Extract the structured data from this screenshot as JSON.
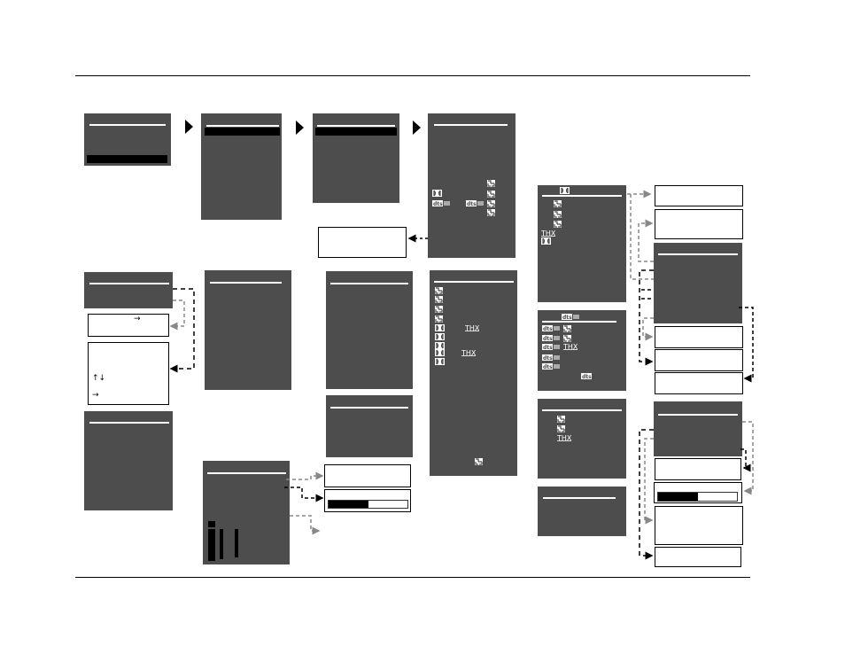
{
  "diagram": {
    "title": "",
    "colors": {
      "panel": "#4d4d4d",
      "underline": "#ffffff",
      "highlight": "#000000",
      "connector_dark": "#000000",
      "connector_light": "#888888"
    },
    "panels": [
      {
        "id": "main-menu",
        "highlight_row": "bottom"
      },
      {
        "id": "submenu-1",
        "highlight_row": "top"
      },
      {
        "id": "submenu-2",
        "highlight_row": "top"
      },
      {
        "id": "mode-list-1",
        "icons": [
          "logic7",
          "logic7",
          "dolby-digital",
          "logic7",
          "dts-es",
          "dts-es",
          "logic7",
          "logic7"
        ]
      },
      {
        "id": "setup-panel-left"
      },
      {
        "id": "setup-panel-left-2"
      },
      {
        "id": "setup-panel-mid"
      },
      {
        "id": "setup-panel-mid-2"
      },
      {
        "id": "setup-panel-mid-3"
      },
      {
        "id": "mode-list-2",
        "icons": [
          "logic7",
          "logic7",
          "logic7",
          "logic7",
          "dolby-digital",
          "thx",
          "dolby-digital",
          "dolby-digital",
          "dolby-digital",
          "thx",
          "dolby-digital",
          "logic7"
        ]
      },
      {
        "id": "level-panel",
        "meter_levels": [
          0.95,
          0.75,
          0.75
        ]
      },
      {
        "id": "dd-mode-panel",
        "header_icon": "dolby-digital",
        "icons": [
          "logic7",
          "logic7",
          "logic7",
          "thx",
          "dolby-digital"
        ]
      },
      {
        "id": "dts-mode-panel",
        "header_icon": "dts-es",
        "icons": [
          "dts-es",
          "logic7",
          "dts-es",
          "logic7",
          "dts-es",
          "thx",
          "dts-es",
          "dts-es",
          "dts"
        ]
      },
      {
        "id": "stereo-mode-panel",
        "icons": [
          "logic7",
          "logic7",
          "thx"
        ]
      },
      {
        "id": "small-panel-right"
      },
      {
        "id": "right-panel-1"
      },
      {
        "id": "right-panel-2"
      }
    ],
    "info_boxes": [
      {
        "id": "info-left-1",
        "glyphs": [
          "arrow-right"
        ]
      },
      {
        "id": "info-left-2",
        "glyphs": [
          "arrow-up",
          "arrow-down",
          "arrow-right"
        ]
      },
      {
        "id": "info-center"
      },
      {
        "id": "info-level-1"
      },
      {
        "id": "info-level-2",
        "progress": 0.5
      },
      {
        "id": "info-right-1"
      },
      {
        "id": "info-right-2"
      },
      {
        "id": "info-right-3"
      },
      {
        "id": "info-right-4"
      },
      {
        "id": "info-right-5"
      },
      {
        "id": "info-right-6"
      },
      {
        "id": "info-right-7",
        "progress": 0.5
      },
      {
        "id": "info-right-8"
      },
      {
        "id": "info-right-9"
      }
    ],
    "flow_arrows": [
      "next-step",
      "next-step",
      "next-step"
    ]
  }
}
